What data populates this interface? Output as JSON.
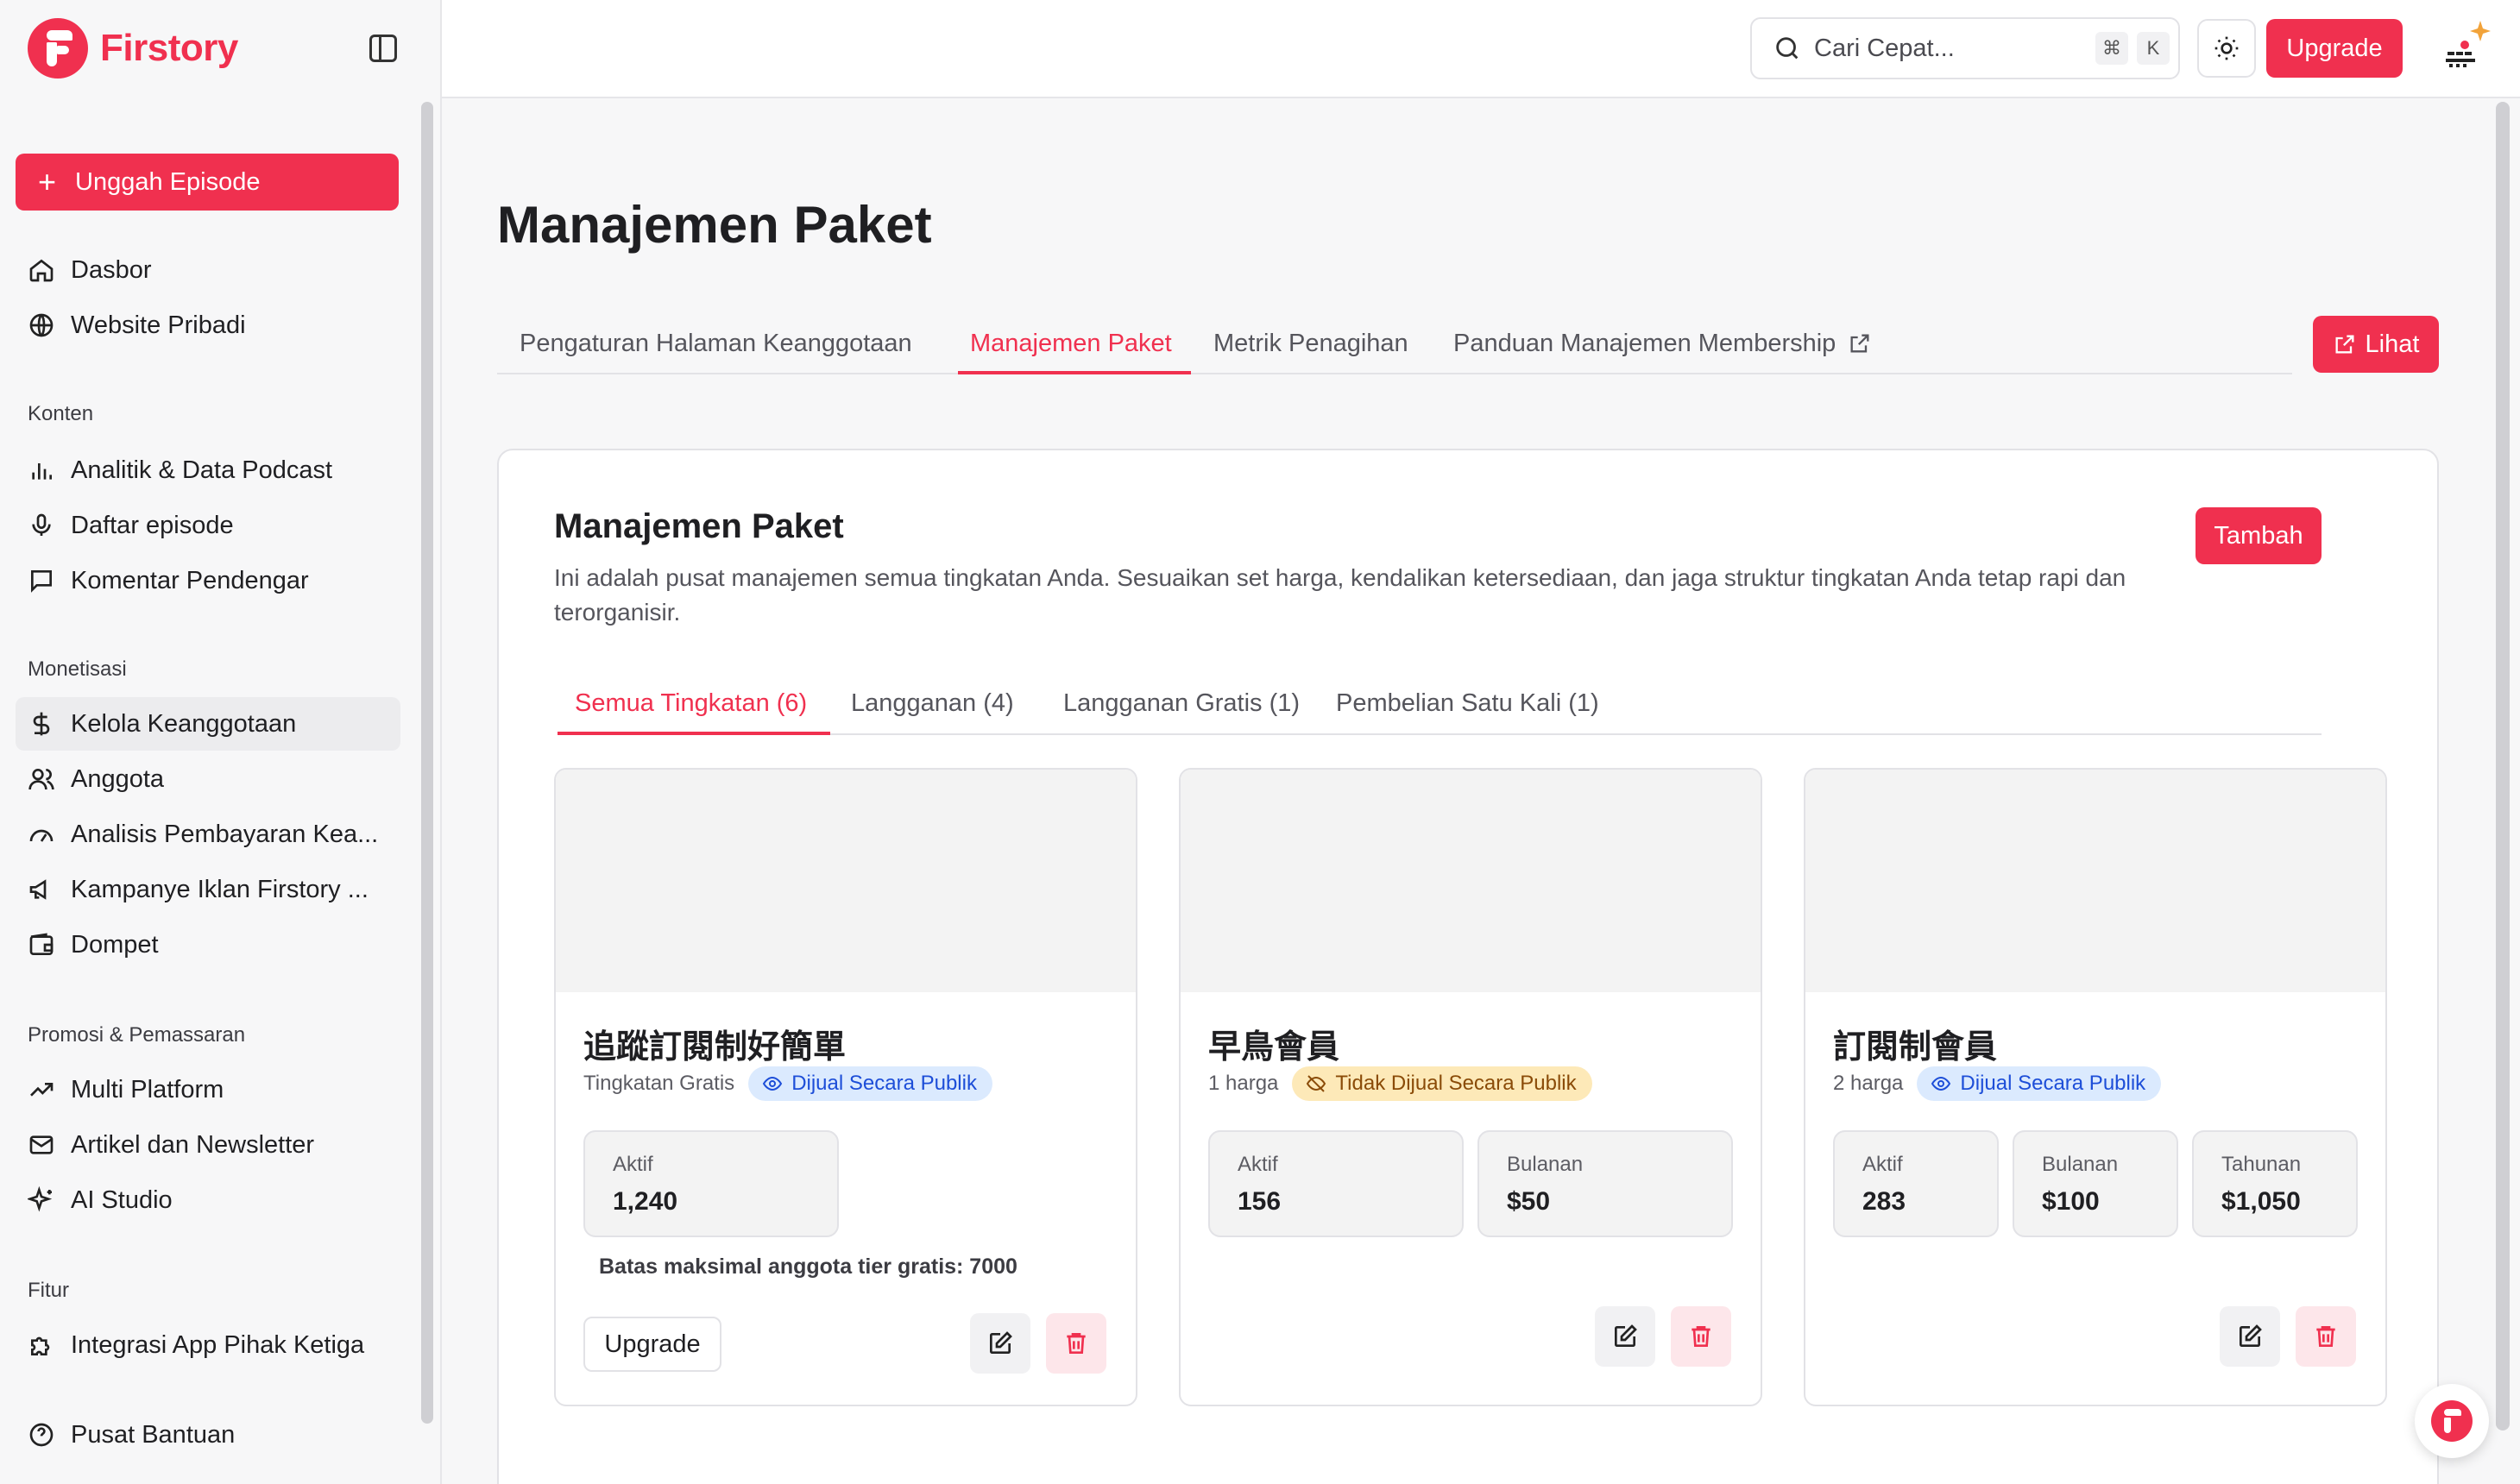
{
  "app": {
    "name": "Firstory"
  },
  "sidebar": {
    "upload_label": "Unggah Episode",
    "top_items": [
      {
        "label": "Dasbor",
        "icon": "home-icon"
      },
      {
        "label": "Website Pribadi",
        "icon": "globe-icon"
      }
    ],
    "sections": [
      {
        "title": "Konten",
        "items": [
          {
            "label": "Analitik & Data Podcast",
            "icon": "bar-chart-icon"
          },
          {
            "label": "Daftar episode",
            "icon": "microphone-icon"
          },
          {
            "label": "Komentar Pendengar",
            "icon": "comment-icon"
          }
        ]
      },
      {
        "title": "Monetisasi",
        "items": [
          {
            "label": "Kelola Keanggotaan",
            "icon": "dollar-icon",
            "active": true
          },
          {
            "label": "Anggota",
            "icon": "users-icon"
          },
          {
            "label": "Analisis Pembayaran Kea...",
            "icon": "gauge-icon"
          },
          {
            "label": "Kampanye Iklan Firstory ...",
            "icon": "megaphone-icon"
          },
          {
            "label": "Dompet",
            "icon": "wallet-icon"
          }
        ]
      },
      {
        "title": "Promosi & Pemassaran",
        "items": [
          {
            "label": "Multi Platform",
            "icon": "trend-icon"
          },
          {
            "label": "Artikel dan Newsletter",
            "icon": "mail-icon"
          },
          {
            "label": "AI Studio",
            "icon": "sparkle-icon"
          }
        ]
      },
      {
        "title": "Fitur",
        "items": [
          {
            "label": "Integrasi App Pihak Ketiga",
            "icon": "puzzle-icon"
          }
        ]
      }
    ],
    "help_label": "Pusat Bantuan"
  },
  "topbar": {
    "search_placeholder": "Cari Cepat...",
    "shortcut_keys": [
      "⌘",
      "K"
    ],
    "upgrade_label": "Upgrade"
  },
  "page": {
    "title": "Manajemen Paket",
    "tabs": [
      {
        "label": "Pengaturan Halaman Keanggotaan"
      },
      {
        "label": "Manajemen Paket",
        "active": true
      },
      {
        "label": "Metrik Penagihan"
      },
      {
        "label": "Panduan Manajemen Membership",
        "external": true
      }
    ],
    "view_label": "Lihat"
  },
  "panel": {
    "title": "Manajemen Paket",
    "description": "Ini adalah pusat manajemen semua tingkatan Anda. Sesuaikan set harga, kendalikan ketersediaan, dan jaga struktur tingkatan Anda tetap rapi dan terorganisir.",
    "add_label": "Tambah",
    "subtabs": [
      {
        "label": "Semua Tingkatan (6)",
        "active": true
      },
      {
        "label": "Langganan (4)"
      },
      {
        "label": "Langganan Gratis (1)"
      },
      {
        "label": "Pembelian Satu Kali (1)"
      }
    ],
    "cards": [
      {
        "name": "追蹤訂閱制好簡單",
        "meta": "Tingkatan Gratis",
        "badge": "Dijual Secara Publik",
        "stats": [
          {
            "label": "Aktif",
            "value": "1,240"
          }
        ],
        "note": "Batas maksimal anggota tier gratis: 7000",
        "upgrade_label": "Upgrade"
      },
      {
        "name": "早鳥會員",
        "meta": "1 harga",
        "badge": "Tidak Dijual Secara Publik",
        "stats": [
          {
            "label": "Aktif",
            "value": "156"
          },
          {
            "label": "Bulanan",
            "value": "$50"
          }
        ]
      },
      {
        "name": "訂閱制會員",
        "meta": "2 harga",
        "badge": "Dijual Secara Publik",
        "stats": [
          {
            "label": "Aktif",
            "value": "283"
          },
          {
            "label": "Bulanan",
            "value": "$100"
          },
          {
            "label": "Tahunan",
            "value": "$1,050"
          }
        ]
      }
    ]
  },
  "colors": {
    "accent": "#f0304f",
    "public_badge": "#dbeafe",
    "private_badge": "#fde9b8"
  }
}
